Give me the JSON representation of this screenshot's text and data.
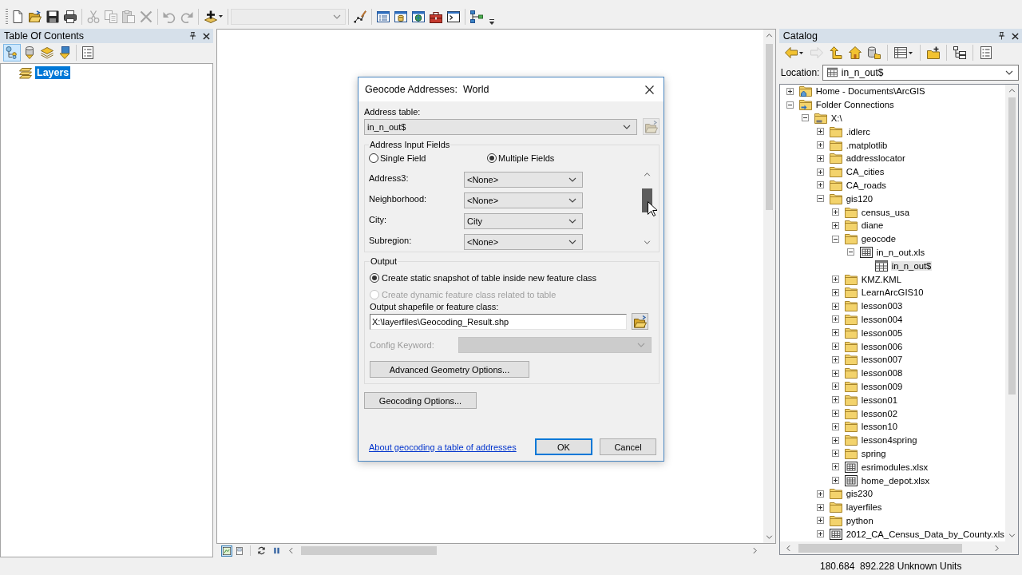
{
  "toolbar": {
    "groups": [
      [
        {
          "kind": "new",
          "disabled": false
        },
        {
          "kind": "open",
          "disabled": false
        },
        {
          "kind": "save",
          "disabled": false
        },
        {
          "kind": "print",
          "disabled": false
        }
      ],
      [
        {
          "kind": "cut",
          "disabled": true
        },
        {
          "kind": "copy",
          "disabled": true
        },
        {
          "kind": "paste",
          "disabled": true
        },
        {
          "kind": "delete",
          "disabled": true
        }
      ],
      [
        {
          "kind": "undo",
          "disabled": true
        },
        {
          "kind": "redo",
          "disabled": true
        }
      ],
      [
        {
          "kind": "add-data",
          "disabled": false
        }
      ],
      [
        {
          "kind": "scale",
          "disabled": true
        }
      ],
      [
        {
          "kind": "editor",
          "disabled": false
        }
      ],
      [
        {
          "kind": "toc-window",
          "disabled": false
        },
        {
          "kind": "catalog-window",
          "disabled": false
        },
        {
          "kind": "search-window",
          "disabled": false
        },
        {
          "kind": "toolbox",
          "disabled": false
        },
        {
          "kind": "python",
          "disabled": false
        }
      ],
      [
        {
          "kind": "modelbuilder",
          "disabled": false
        }
      ]
    ]
  },
  "table_of_contents": {
    "title": "Table Of Contents",
    "views": [
      {
        "kind": "drawing-order",
        "selected": true
      },
      {
        "kind": "source",
        "selected": false
      },
      {
        "kind": "visibility",
        "selected": false
      },
      {
        "kind": "selection",
        "selected": false
      }
    ],
    "layers": [
      {
        "label": "Layers",
        "selected": true
      }
    ]
  },
  "map_view": {
    "views": [
      {
        "kind": "data-view",
        "selected": true
      },
      {
        "kind": "layout-view",
        "selected": false
      }
    ]
  },
  "dialog": {
    "title": "Geocode Addresses:  World",
    "address_table": {
      "label": "Address table:",
      "value": "in_n_out$",
      "browse_disabled": true
    },
    "input_fields": {
      "legend": "Address Input Fields",
      "modes": [
        {
          "label": "Single Field",
          "selected": false
        },
        {
          "label": "Multiple Fields",
          "selected": true
        }
      ],
      "fields": [
        {
          "label": "Address3:",
          "value": "<None>"
        },
        {
          "label": "Neighborhood:",
          "value": "<None>"
        },
        {
          "label": "City:",
          "value": "City"
        },
        {
          "label": "Subregion:",
          "value": "<None>"
        }
      ]
    },
    "output": {
      "legend": "Output",
      "options": [
        {
          "label": "Create static snapshot of table inside new feature class",
          "selected": true,
          "disabled": false
        },
        {
          "label": "Create dynamic feature class related to table",
          "selected": false,
          "disabled": true
        }
      ],
      "path_label": "Output shapefile or feature class:",
      "path_value": "X:\\layerfiles\\Geocoding_Result.shp",
      "browse_disabled": false,
      "config": {
        "label": "Config Keyword:",
        "disabled": true
      },
      "advanced_button": "Advanced Geometry Options..."
    },
    "geocoding_options_button": "Geocoding Options...",
    "help_link": "About geocoding a table of addresses",
    "buttons": [
      {
        "label": "OK",
        "default": true
      },
      {
        "label": "Cancel",
        "default": false
      }
    ]
  },
  "catalog": {
    "title": "Catalog",
    "toolbar": [
      [
        {
          "kind": "back",
          "disabled": false
        },
        {
          "kind": "forward",
          "disabled": true
        },
        {
          "kind": "up",
          "disabled": false
        },
        {
          "kind": "home",
          "disabled": false
        },
        {
          "kind": "connect",
          "disabled": false
        }
      ],
      [
        {
          "kind": "views",
          "disabled": false
        }
      ],
      [
        {
          "kind": "new-folder",
          "disabled": false
        }
      ],
      [
        {
          "kind": "tree-toggle",
          "disabled": false
        }
      ],
      [
        {
          "kind": "options",
          "disabled": false
        }
      ]
    ],
    "location": {
      "label": "Location:",
      "value": "in_n_out$"
    },
    "tree": [
      {
        "label": "Home - Documents\\ArcGIS",
        "kind": "home",
        "expanded": false,
        "selected": false
      },
      {
        "label": "Folder Connections",
        "kind": "connections",
        "expanded": true,
        "selected": false,
        "children": [
          {
            "label": "X:\\",
            "kind": "drive",
            "expanded": true,
            "selected": false,
            "children": [
              {
                "label": ".idlerc",
                "kind": "folder",
                "expanded": false,
                "selected": false
              },
              {
                "label": ".matplotlib",
                "kind": "folder",
                "expanded": false,
                "selected": false
              },
              {
                "label": "addresslocator",
                "kind": "folder",
                "expanded": false,
                "selected": false
              },
              {
                "label": "CA_cities",
                "kind": "folder",
                "expanded": false,
                "selected": false
              },
              {
                "label": "CA_roads",
                "kind": "folder",
                "expanded": false,
                "selected": false
              },
              {
                "label": "gis120",
                "kind": "folder",
                "expanded": true,
                "selected": false,
                "children": [
                  {
                    "label": "census_usa",
                    "kind": "folder",
                    "expanded": false,
                    "selected": false
                  },
                  {
                    "label": "diane",
                    "kind": "folder",
                    "expanded": false,
                    "selected": false
                  },
                  {
                    "label": "geocode",
                    "kind": "folder",
                    "expanded": true,
                    "selected": false,
                    "children": [
                      {
                        "label": "in_n_out.xls",
                        "kind": "workbook",
                        "expanded": true,
                        "selected": false,
                        "children": [
                          {
                            "label": "in_n_out$",
                            "kind": "table",
                            "selected": true
                          }
                        ]
                      }
                    ]
                  },
                  {
                    "label": "KMZ.KML",
                    "kind": "folder",
                    "expanded": false,
                    "selected": false
                  },
                  {
                    "label": "LearnArcGIS10",
                    "kind": "folder",
                    "expanded": false,
                    "selected": false
                  },
                  {
                    "label": "lesson003",
                    "kind": "folder",
                    "expanded": false,
                    "selected": false
                  },
                  {
                    "label": "lesson004",
                    "kind": "folder",
                    "expanded": false,
                    "selected": false
                  },
                  {
                    "label": "lesson005",
                    "kind": "folder",
                    "expanded": false,
                    "selected": false
                  },
                  {
                    "label": "lesson006",
                    "kind": "folder",
                    "expanded": false,
                    "selected": false
                  },
                  {
                    "label": "lesson007",
                    "kind": "folder",
                    "expanded": false,
                    "selected": false
                  },
                  {
                    "label": "lesson008",
                    "kind": "folder",
                    "expanded": false,
                    "selected": false
                  },
                  {
                    "label": "lesson009",
                    "kind": "folder",
                    "expanded": false,
                    "selected": false
                  },
                  {
                    "label": "lesson01",
                    "kind": "folder",
                    "expanded": false,
                    "selected": false
                  },
                  {
                    "label": "lesson02",
                    "kind": "folder",
                    "expanded": false,
                    "selected": false
                  },
                  {
                    "label": "lesson10",
                    "kind": "folder",
                    "expanded": false,
                    "selected": false
                  },
                  {
                    "label": "lesson4spring",
                    "kind": "folder",
                    "expanded": false,
                    "selected": false
                  },
                  {
                    "label": "spring",
                    "kind": "folder",
                    "expanded": false,
                    "selected": false
                  },
                  {
                    "label": "esrimodules.xlsx",
                    "kind": "workbook",
                    "expanded": false,
                    "selected": false
                  },
                  {
                    "label": "home_depot.xlsx",
                    "kind": "workbook",
                    "expanded": false,
                    "selected": false
                  }
                ]
              },
              {
                "label": "gis230",
                "kind": "folder",
                "expanded": false,
                "selected": false
              },
              {
                "label": "layerfiles",
                "kind": "folder",
                "expanded": false,
                "selected": false
              },
              {
                "label": "python",
                "kind": "folder",
                "expanded": false,
                "selected": false
              },
              {
                "label": "2012_CA_Census_Data_by_County.xls",
                "kind": "workbook",
                "expanded": false,
                "selected": false
              }
            ]
          }
        ]
      }
    ]
  },
  "status_bar": {
    "coordinates": "180.684  892.228 Unknown Units"
  }
}
